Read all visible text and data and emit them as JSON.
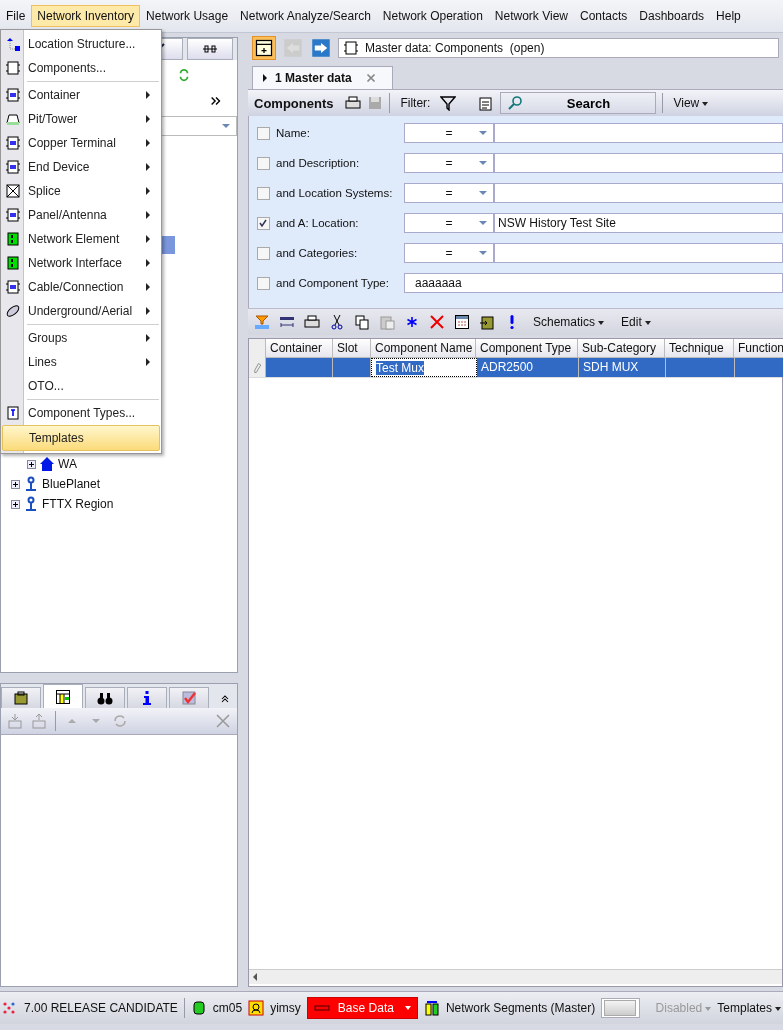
{
  "menubar": [
    {
      "label": "File",
      "selected": false
    },
    {
      "label": "Network Inventory",
      "selected": true
    },
    {
      "label": "Network Usage",
      "selected": false
    },
    {
      "label": "Network Analyze/Search",
      "selected": false
    },
    {
      "label": "Network Operation",
      "selected": false
    },
    {
      "label": "Network View",
      "selected": false
    },
    {
      "label": "Contacts",
      "selected": false
    },
    {
      "label": "Dashboards",
      "selected": false
    },
    {
      "label": "Help",
      "selected": false
    }
  ],
  "dropdown": {
    "groups": [
      [
        {
          "label": "Location Structure...",
          "submenu": false,
          "highlighted": false
        },
        {
          "label": "Components...",
          "submenu": false,
          "highlighted": false
        }
      ],
      [
        {
          "label": "Container",
          "submenu": true,
          "highlighted": false
        },
        {
          "label": "Pit/Tower",
          "submenu": true,
          "highlighted": false
        },
        {
          "label": "Copper Terminal",
          "submenu": true,
          "highlighted": false
        },
        {
          "label": "End Device",
          "submenu": true,
          "highlighted": false
        },
        {
          "label": "Splice",
          "submenu": true,
          "highlighted": false
        },
        {
          "label": "Panel/Antenna",
          "submenu": true,
          "highlighted": false
        },
        {
          "label": "Network Element",
          "submenu": true,
          "highlighted": false
        },
        {
          "label": "Network Interface",
          "submenu": true,
          "highlighted": false
        },
        {
          "label": "Cable/Connection",
          "submenu": true,
          "highlighted": false
        },
        {
          "label": "Underground/Aerial",
          "submenu": true,
          "highlighted": false
        }
      ],
      [
        {
          "label": "Groups",
          "submenu": true,
          "highlighted": false
        },
        {
          "label": "Lines",
          "submenu": true,
          "highlighted": false
        },
        {
          "label": "OTO...",
          "submenu": false,
          "highlighted": false
        }
      ],
      [
        {
          "label": "Component Types...",
          "submenu": false,
          "highlighted": false
        },
        {
          "label": "Templates",
          "submenu": false,
          "highlighted": true
        }
      ]
    ]
  },
  "tree": [
    {
      "label": "WA",
      "expanded": false
    },
    {
      "label": "BluePlanet",
      "expanded": false
    },
    {
      "label": "FTTX Region",
      "expanded": false
    }
  ],
  "bottom_tabs": [
    {
      "selected": false
    },
    {
      "selected": true
    },
    {
      "selected": false
    },
    {
      "selected": false
    },
    {
      "selected": false
    }
  ],
  "address": "Master data: Components  (open)",
  "doc_tab": {
    "label": "1 Master data",
    "selected": true
  },
  "toolbar": {
    "title": "Components",
    "filter": "Filter:",
    "search": "Search",
    "view": "View"
  },
  "filters": [
    {
      "kind": "compare",
      "label": "Name:",
      "checked": false,
      "operator": "="
    },
    {
      "kind": "compare",
      "label": "and Description:",
      "checked": false,
      "operator": "="
    },
    {
      "kind": "compare",
      "label": "and Location Systems:",
      "checked": false,
      "operator": "="
    },
    {
      "kind": "compare",
      "label": "and A: Location:",
      "checked": true,
      "operator": "=",
      "value": "NSW History Test Site"
    },
    {
      "kind": "compare",
      "label": "and Categories:",
      "checked": false,
      "operator": "="
    },
    {
      "kind": "text",
      "label": "and Component Type:",
      "checked": false,
      "value": "aaaaaaa"
    }
  ],
  "grid_toolbar": {
    "schematics": "Schematics",
    "edit": "Edit"
  },
  "table": {
    "columns": [
      "Container",
      "Slot",
      "Component Name",
      "Component Type",
      "Sub-Category",
      "Technique",
      "Function"
    ],
    "rows": [
      {
        "selected": true,
        "cells": [
          "",
          "",
          "Test Mux",
          "ADR2500",
          "SDH MUX",
          "",
          ""
        ]
      }
    ]
  },
  "status_bar": {
    "version": "7.00 RELEASE CANDIDATE",
    "database": "cm05",
    "user": "yimsy",
    "base_data": "Base Data",
    "segments": "Network Segments (Master)",
    "disabled": "Disabled",
    "templates": "Templates"
  }
}
